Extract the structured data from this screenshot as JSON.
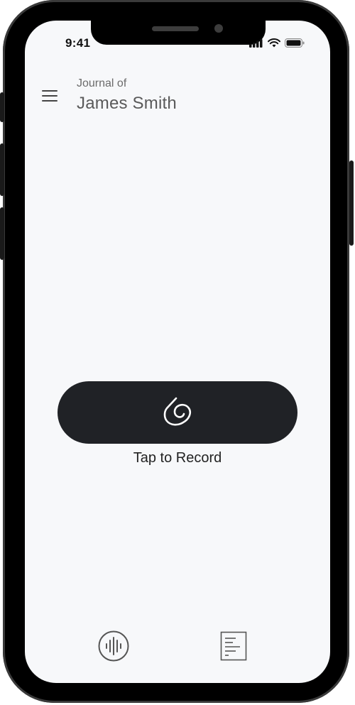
{
  "status_bar": {
    "time": "9:41",
    "icons": [
      "signal-icon",
      "wifi-icon",
      "battery-icon"
    ]
  },
  "header": {
    "menu_icon": "hamburger-menu-icon",
    "subtitle": "Journal of",
    "title": "James Smith"
  },
  "record": {
    "icon": "spiral-logo-icon",
    "label": "Tap to Record"
  },
  "bottom_nav": {
    "items": [
      {
        "icon": "voice-waveform-icon"
      },
      {
        "icon": "document-list-icon"
      }
    ]
  },
  "colors": {
    "screen_bg": "#f7f8fa",
    "record_button": "#202226",
    "text_primary": "#222222",
    "text_secondary": "#6b6b6b"
  }
}
